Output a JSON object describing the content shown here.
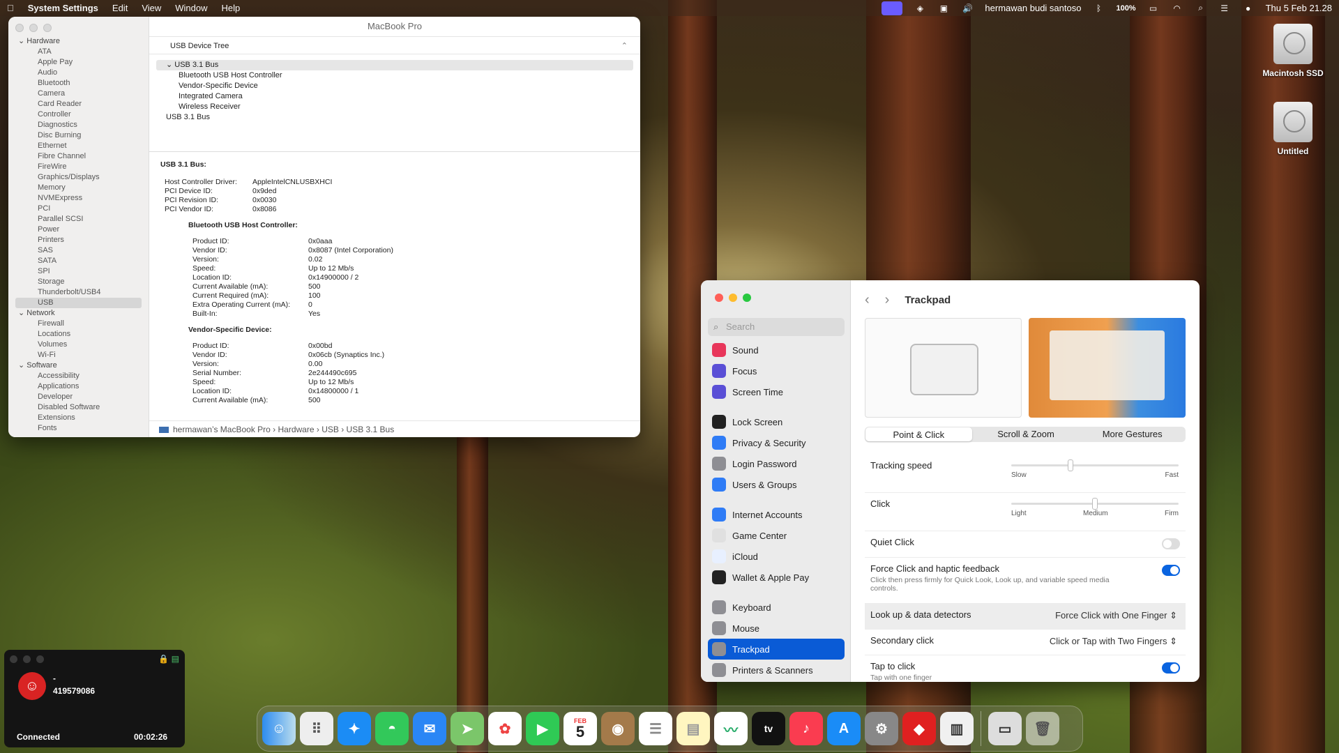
{
  "menubar": {
    "app": "System Settings",
    "menus": [
      "Edit",
      "View",
      "Window",
      "Help"
    ],
    "user": "hermawan budi santoso",
    "battery": "100%",
    "clock": "Thu 5 Feb  21.28"
  },
  "desktop": {
    "icons": [
      {
        "label": "Macintosh SSD"
      },
      {
        "label": "Untitled"
      }
    ]
  },
  "sysinfo": {
    "title": "MacBook Pro",
    "sidebar": {
      "hardware": "Hardware",
      "hardware_items": [
        "ATA",
        "Apple Pay",
        "Audio",
        "Bluetooth",
        "Camera",
        "Card Reader",
        "Controller",
        "Diagnostics",
        "Disc Burning",
        "Ethernet",
        "Fibre Channel",
        "FireWire",
        "Graphics/Displays",
        "Memory",
        "NVMExpress",
        "PCI",
        "Parallel SCSI",
        "Power",
        "Printers",
        "SAS",
        "SATA",
        "SPI",
        "Storage",
        "Thunderbolt/USB4",
        "USB"
      ],
      "network": "Network",
      "network_items": [
        "Firewall",
        "Locations",
        "Volumes",
        "Wi-Fi"
      ],
      "software": "Software",
      "software_items": [
        "Accessibility",
        "Applications",
        "Developer",
        "Disabled Software",
        "Extensions",
        "Fonts"
      ]
    },
    "tree_header": "USB Device Tree",
    "tree": {
      "bus1": "USB 3.1 Bus",
      "children": [
        "Bluetooth USB Host Controller",
        "Vendor-Specific Device",
        "Integrated Camera",
        "Wireless Receiver"
      ],
      "bus2": "USB 3.1 Bus"
    },
    "details": {
      "heading": "USB 3.1 Bus:",
      "bus_props": [
        [
          "Host Controller Driver:",
          "AppleIntelCNLUSBXHCI"
        ],
        [
          "PCI Device ID:",
          "0x9ded"
        ],
        [
          "PCI Revision ID:",
          "0x0030"
        ],
        [
          "PCI Vendor ID:",
          "0x8086"
        ]
      ],
      "dev1": {
        "heading": "Bluetooth USB Host Controller:",
        "props": [
          [
            "Product ID:",
            "0x0aaa"
          ],
          [
            "Vendor ID:",
            "0x8087  (Intel Corporation)"
          ],
          [
            "Version:",
            "0.02"
          ],
          [
            "Speed:",
            "Up to 12 Mb/s"
          ],
          [
            "Location ID:",
            "0x14900000 / 2"
          ],
          [
            "Current Available (mA):",
            "500"
          ],
          [
            "Current Required (mA):",
            "100"
          ],
          [
            "Extra Operating Current (mA):",
            "0"
          ],
          [
            "Built-In:",
            "Yes"
          ]
        ]
      },
      "dev2": {
        "heading": "Vendor-Specific Device:",
        "props": [
          [
            "Product ID:",
            "0x00bd"
          ],
          [
            "Vendor ID:",
            "0x06cb  (Synaptics Inc.)"
          ],
          [
            "Version:",
            "0.00"
          ],
          [
            "Serial Number:",
            "2e244490c695"
          ],
          [
            "Speed:",
            "Up to 12 Mb/s"
          ],
          [
            "Location ID:",
            "0x14800000 / 1"
          ],
          [
            "Current Available (mA):",
            "500"
          ]
        ]
      }
    },
    "path": "hermawan’s MacBook Pro  ›  Hardware  ›  USB  ›  USB 3.1 Bus"
  },
  "settings": {
    "search_placeholder": "Search",
    "nav": [
      {
        "label": "Sound",
        "icon": "sound-icon",
        "color": "#e8365a"
      },
      {
        "label": "Focus",
        "icon": "focus-icon",
        "color": "#5a4fd6"
      },
      {
        "label": "Screen Time",
        "icon": "screen-time-icon",
        "color": "#5a4fd6"
      },
      {
        "label": "Lock Screen",
        "icon": "lock-screen-icon",
        "color": "#222222"
      },
      {
        "label": "Privacy & Security",
        "icon": "privacy-icon",
        "color": "#2f7cf6"
      },
      {
        "label": "Login Password",
        "icon": "login-password-icon",
        "color": "#8e8e93"
      },
      {
        "label": "Users & Groups",
        "icon": "users-icon",
        "color": "#2f7cf6"
      },
      {
        "label": "Internet Accounts",
        "icon": "internet-accounts-icon",
        "color": "#2f7cf6"
      },
      {
        "label": "Game Center",
        "icon": "game-center-icon",
        "color": "#e0e0e0"
      },
      {
        "label": "iCloud",
        "icon": "icloud-icon",
        "color": "#e8f0ff"
      },
      {
        "label": "Wallet & Apple Pay",
        "icon": "wallet-icon",
        "color": "#222222"
      },
      {
        "label": "Keyboard",
        "icon": "keyboard-icon",
        "color": "#8e8e93"
      },
      {
        "label": "Mouse",
        "icon": "mouse-icon",
        "color": "#8e8e93"
      },
      {
        "label": "Trackpad",
        "icon": "trackpad-icon",
        "color": "#8e8e93"
      },
      {
        "label": "Printers & Scanners",
        "icon": "printer-icon",
        "color": "#8e8e93"
      }
    ],
    "title": "Trackpad",
    "tabs": [
      "Point & Click",
      "Scroll & Zoom",
      "More Gestures"
    ],
    "tracking": {
      "label": "Tracking speed",
      "min": "Slow",
      "max": "Fast",
      "value": 0.35
    },
    "click": {
      "label": "Click",
      "l1": "Light",
      "l2": "Medium",
      "l3": "Firm",
      "value": 0.5
    },
    "quiet": {
      "label": "Quiet Click",
      "on": false
    },
    "force": {
      "label": "Force Click and haptic feedback",
      "desc": "Click then press firmly for Quick Look, Look up, and variable speed media controls.",
      "on": true
    },
    "lookup": {
      "label": "Look up & data detectors",
      "value": "Force Click with One Finger"
    },
    "secondary": {
      "label": "Secondary click",
      "value": "Click or Tap with Two Fingers"
    },
    "tap": {
      "label": "Tap to click",
      "desc": "Tap with one finger",
      "on": true
    }
  },
  "call": {
    "name": "-",
    "number": "419579086",
    "status": "Connected",
    "duration": "00:02:26"
  },
  "dock": {
    "date_month": "FEB",
    "date_day": "5",
    "tv": "tv"
  }
}
